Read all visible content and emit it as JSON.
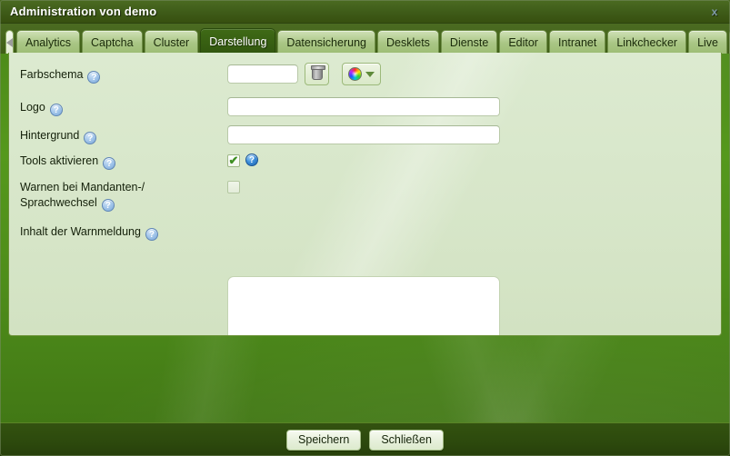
{
  "window": {
    "title": "Administration von demo",
    "close_icon": "close-icon",
    "close_label": "x"
  },
  "tabs": {
    "scroll_left_icon": "triangle-left-icon",
    "scroll_right_icon": "triangle-right-icon",
    "overflow_icon": "chevron-down-icon",
    "items": [
      {
        "label": "Analytics",
        "active": false
      },
      {
        "label": "Captcha",
        "active": false
      },
      {
        "label": "Cluster",
        "active": false
      },
      {
        "label": "Darstellung",
        "active": true
      },
      {
        "label": "Datensicherung",
        "active": false
      },
      {
        "label": "Desklets",
        "active": false
      },
      {
        "label": "Dienste",
        "active": false
      },
      {
        "label": "Editor",
        "active": false
      },
      {
        "label": "Intranet",
        "active": false
      },
      {
        "label": "Linkchecker",
        "active": false
      },
      {
        "label": "Live",
        "active": false
      }
    ]
  },
  "form": {
    "help_glyph": "?",
    "farbschema": {
      "label": "Farbschema",
      "value": "",
      "placeholder": "",
      "clear_icon": "trash-icon",
      "picker_icon": "color-wheel-icon",
      "picker_caret_icon": "caret-down-icon"
    },
    "logo": {
      "label": "Logo",
      "value": "",
      "placeholder": ""
    },
    "hintergrund": {
      "label": "Hintergrund",
      "value": "",
      "placeholder": ""
    },
    "tools_aktivieren": {
      "label": "Tools aktivieren",
      "checked": true,
      "check_glyph": "✔"
    },
    "warnen_wechsel": {
      "label": "Warnen bei Mandanten-/ Sprachwechsel",
      "checked": false
    },
    "warnmeldung": {
      "label": "Inhalt der Warnmeldung",
      "value": "",
      "placeholder": "",
      "resize_icon": "resize-grip-icon"
    }
  },
  "footer": {
    "save_label": "Speichern",
    "close_label": "Schließen"
  },
  "colors": {
    "accent_green": "#4e8d1a",
    "panel_bg": "#d7e6c9",
    "titlebar": "#3f5c19",
    "active_tab": "#32570f",
    "footer": "#2d4a0d"
  }
}
